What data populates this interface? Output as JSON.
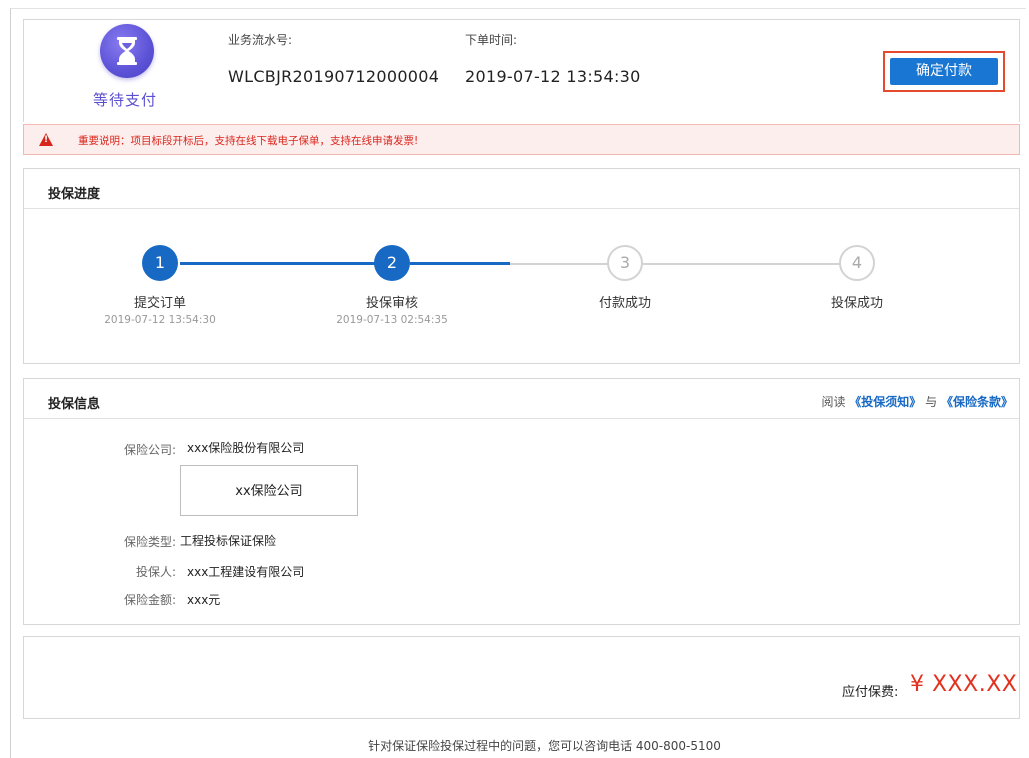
{
  "status": {
    "icon": "hourglass-icon",
    "text": "等待支付"
  },
  "order": {
    "serial_label": "业务流水号:",
    "serial_value": "WLCBJR20190712000004",
    "time_label": "下单时间:",
    "time_value": "2019-07-12 13:54:30"
  },
  "actions": {
    "confirm_pay": "确定付款"
  },
  "notice": {
    "icon": "warning-icon",
    "text": "重要说明：项目标段开标后，支持在线下载电子保单，支持在线申请发票!"
  },
  "progress": {
    "title": "投保进度",
    "steps": [
      {
        "num": "1",
        "label": "提交订单",
        "time": "2019-07-12 13:54:30",
        "done": true
      },
      {
        "num": "2",
        "label": "投保审核",
        "time": "2019-07-13 02:54:35",
        "done": true
      },
      {
        "num": "3",
        "label": "付款成功",
        "time": "",
        "done": false
      },
      {
        "num": "4",
        "label": "投保成功",
        "time": "",
        "done": false
      }
    ]
  },
  "info": {
    "title": "投保信息",
    "read_prefix": "阅读",
    "notice_link": "《投保须知》",
    "conjunction": "与",
    "terms_link": "《保险条款》",
    "company_label": "保险公司:",
    "company_value": "xxx保险股份有限公司",
    "company_logo_text": "xx保险公司",
    "type_label": "保险类型:",
    "type_value": "工程投标保证保险",
    "insured_label": "投保人:",
    "insured_value": "xxx工程建设有限公司",
    "amount_label": "保险金额:",
    "amount_value": "xxx元"
  },
  "fee": {
    "label": "应付保费:",
    "value": "¥ XXX.XX"
  },
  "footer": {
    "text": "针对保证保险投保过程中的问题，您可以咨询电话 400-800-5100"
  },
  "colors": {
    "primary": "#1769c4",
    "danger": "#d9261c",
    "status_purple": "#5a4fcf",
    "fee_red": "#e3311f"
  }
}
